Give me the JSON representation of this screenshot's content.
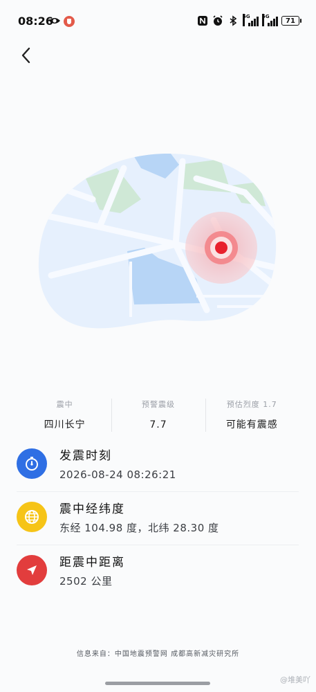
{
  "status_bar": {
    "time": "08:26",
    "battery": "71",
    "network_1": "5G",
    "network_2": "5G"
  },
  "info": {
    "epicenter_label": "震中",
    "epicenter_value": "四川长宁",
    "magnitude_label": "预警震级",
    "magnitude_value": "7.7",
    "intensity_label": "预估烈度 1.7",
    "intensity_value": "可能有震感"
  },
  "details": [
    {
      "title": "发震时刻",
      "value": "2026-08-24 08:26:21",
      "icon": "stopwatch-icon",
      "color": "#2f6fe4"
    },
    {
      "title": "震中经纬度",
      "value": "东经 104.98 度，北纬 28.30 度",
      "icon": "globe-icon",
      "color": "#f6c417"
    },
    {
      "title": "距震中距离",
      "value": "2502 公里",
      "icon": "navigation-icon",
      "color": "#e23d3d"
    }
  ],
  "footer": "信息来自：中国地震预警网 成都高新减灾研究所",
  "watermark": "@堆美吖",
  "colors": {
    "map_base": "#e8f1fd",
    "water": "#b9d7f7",
    "park": "#cde9d5",
    "pulse": "#e8212d"
  }
}
